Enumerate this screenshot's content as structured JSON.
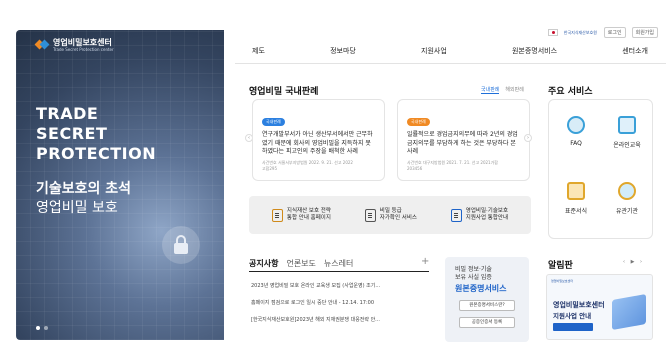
{
  "brand": {
    "name": "영업비밀보호센터",
    "sub": "Trade Secret Protection center"
  },
  "hero": {
    "title_lines": [
      "TRADE",
      "SECRET",
      "PROTECTION"
    ],
    "sub1": "기술보호의 초석",
    "sub2": "영업비밀 보호"
  },
  "util": {
    "org": "한국지식재산보호원",
    "login": "로그인",
    "signup": "회원가입"
  },
  "nav": [
    "제도",
    "정보마당",
    "지원사업",
    "원본증명서비스",
    "센터소개"
  ],
  "cases": {
    "title": "영업비밀 국내판례",
    "tabs": [
      "국내판례",
      "해외판례"
    ],
    "cards": [
      {
        "badge": "국내판례",
        "text": "연구개발부서가 아닌 생산부서에서만 근무하였기 때문에 회사의 영업비밀을 지득하지 못하였다는 피고인의 주장을 배척한 사례",
        "meta1": "사건번호 서울서부지방법원 2022. 9. 21. 선고 2022",
        "meta2": "고합295"
      },
      {
        "badge": "국내판례",
        "text": "일률적으로 경업금지의무에 따라 2년의 경업금지의무를 부담하게 하는 것은 부당하다 본 사례",
        "meta1": "사건번호 대구지방법원 2021. 7. 21. 선고 2021가합",
        "meta2": "203456"
      }
    ]
  },
  "links": [
    {
      "line1": "지식재산 보호 전략",
      "line2": "통합 안내 홈페이지"
    },
    {
      "line1": "비밀 등급",
      "line2": "자가확인 서비스"
    },
    {
      "line1": "영업비밀·기술보호",
      "line2": "지원사업 통합안내"
    }
  ],
  "services": {
    "title": "주요 서비스",
    "items": [
      "FAQ",
      "온라인교육",
      "표준서식",
      "유관기관"
    ]
  },
  "notice": {
    "tabs": [
      "공지사항",
      "언론보도",
      "뉴스레터"
    ],
    "plus": "+",
    "items": [
      "2023년 영업비밀 보호 온라인 교육생 모집 (사업운영) 조기...",
      "홈페이지 점검으로 로그인 일시 중단 안내 - 12.14. 17:00",
      "[한국지식재산보호원]2023년 해외 지재권분쟁 대응전략 안..."
    ]
  },
  "orig": {
    "l1": "비밀 정보·기술",
    "l1b": "보유 사실 입증",
    "l2": "원본증명서비스",
    "b1": "원본증명서비스란?",
    "b2": "공증인증서 등록"
  },
  "alarm": {
    "title": "알림판",
    "ctrl": "‹ ▶ ›",
    "logo": "영업비밀보호센터",
    "t1": "영업비밀보호센터",
    "t2": "지원사업 안내"
  },
  "colors": {
    "accent": "#1e6fd9",
    "badge": "#2c80e0",
    "badge2": "#f08a24"
  }
}
